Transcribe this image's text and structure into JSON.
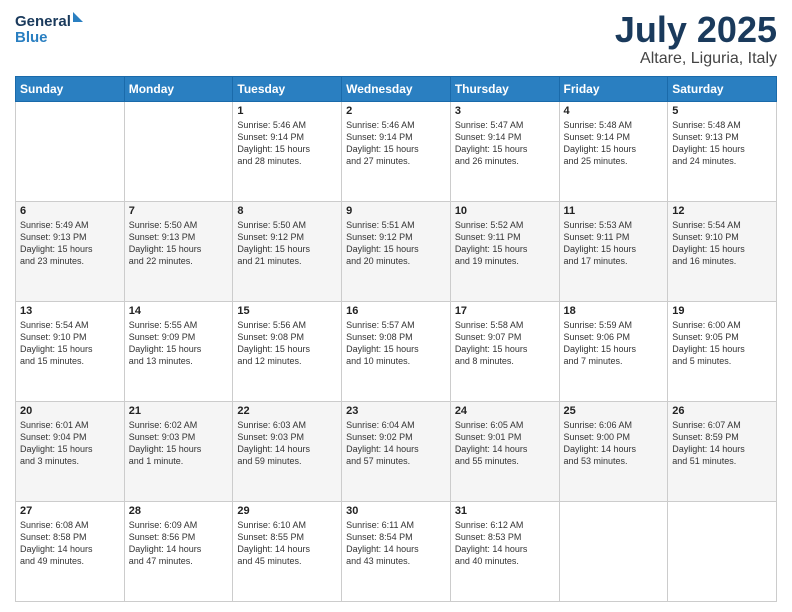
{
  "header": {
    "logo_line1": "General",
    "logo_line2": "Blue",
    "main_title": "July 2025",
    "subtitle": "Altare, Liguria, Italy"
  },
  "days_of_week": [
    "Sunday",
    "Monday",
    "Tuesday",
    "Wednesday",
    "Thursday",
    "Friday",
    "Saturday"
  ],
  "weeks": [
    [
      {
        "day": "",
        "content": ""
      },
      {
        "day": "",
        "content": ""
      },
      {
        "day": "1",
        "content": "Sunrise: 5:46 AM\nSunset: 9:14 PM\nDaylight: 15 hours\nand 28 minutes."
      },
      {
        "day": "2",
        "content": "Sunrise: 5:46 AM\nSunset: 9:14 PM\nDaylight: 15 hours\nand 27 minutes."
      },
      {
        "day": "3",
        "content": "Sunrise: 5:47 AM\nSunset: 9:14 PM\nDaylight: 15 hours\nand 26 minutes."
      },
      {
        "day": "4",
        "content": "Sunrise: 5:48 AM\nSunset: 9:14 PM\nDaylight: 15 hours\nand 25 minutes."
      },
      {
        "day": "5",
        "content": "Sunrise: 5:48 AM\nSunset: 9:13 PM\nDaylight: 15 hours\nand 24 minutes."
      }
    ],
    [
      {
        "day": "6",
        "content": "Sunrise: 5:49 AM\nSunset: 9:13 PM\nDaylight: 15 hours\nand 23 minutes."
      },
      {
        "day": "7",
        "content": "Sunrise: 5:50 AM\nSunset: 9:13 PM\nDaylight: 15 hours\nand 22 minutes."
      },
      {
        "day": "8",
        "content": "Sunrise: 5:50 AM\nSunset: 9:12 PM\nDaylight: 15 hours\nand 21 minutes."
      },
      {
        "day": "9",
        "content": "Sunrise: 5:51 AM\nSunset: 9:12 PM\nDaylight: 15 hours\nand 20 minutes."
      },
      {
        "day": "10",
        "content": "Sunrise: 5:52 AM\nSunset: 9:11 PM\nDaylight: 15 hours\nand 19 minutes."
      },
      {
        "day": "11",
        "content": "Sunrise: 5:53 AM\nSunset: 9:11 PM\nDaylight: 15 hours\nand 17 minutes."
      },
      {
        "day": "12",
        "content": "Sunrise: 5:54 AM\nSunset: 9:10 PM\nDaylight: 15 hours\nand 16 minutes."
      }
    ],
    [
      {
        "day": "13",
        "content": "Sunrise: 5:54 AM\nSunset: 9:10 PM\nDaylight: 15 hours\nand 15 minutes."
      },
      {
        "day": "14",
        "content": "Sunrise: 5:55 AM\nSunset: 9:09 PM\nDaylight: 15 hours\nand 13 minutes."
      },
      {
        "day": "15",
        "content": "Sunrise: 5:56 AM\nSunset: 9:08 PM\nDaylight: 15 hours\nand 12 minutes."
      },
      {
        "day": "16",
        "content": "Sunrise: 5:57 AM\nSunset: 9:08 PM\nDaylight: 15 hours\nand 10 minutes."
      },
      {
        "day": "17",
        "content": "Sunrise: 5:58 AM\nSunset: 9:07 PM\nDaylight: 15 hours\nand 8 minutes."
      },
      {
        "day": "18",
        "content": "Sunrise: 5:59 AM\nSunset: 9:06 PM\nDaylight: 15 hours\nand 7 minutes."
      },
      {
        "day": "19",
        "content": "Sunrise: 6:00 AM\nSunset: 9:05 PM\nDaylight: 15 hours\nand 5 minutes."
      }
    ],
    [
      {
        "day": "20",
        "content": "Sunrise: 6:01 AM\nSunset: 9:04 PM\nDaylight: 15 hours\nand 3 minutes."
      },
      {
        "day": "21",
        "content": "Sunrise: 6:02 AM\nSunset: 9:03 PM\nDaylight: 15 hours\nand 1 minute."
      },
      {
        "day": "22",
        "content": "Sunrise: 6:03 AM\nSunset: 9:03 PM\nDaylight: 14 hours\nand 59 minutes."
      },
      {
        "day": "23",
        "content": "Sunrise: 6:04 AM\nSunset: 9:02 PM\nDaylight: 14 hours\nand 57 minutes."
      },
      {
        "day": "24",
        "content": "Sunrise: 6:05 AM\nSunset: 9:01 PM\nDaylight: 14 hours\nand 55 minutes."
      },
      {
        "day": "25",
        "content": "Sunrise: 6:06 AM\nSunset: 9:00 PM\nDaylight: 14 hours\nand 53 minutes."
      },
      {
        "day": "26",
        "content": "Sunrise: 6:07 AM\nSunset: 8:59 PM\nDaylight: 14 hours\nand 51 minutes."
      }
    ],
    [
      {
        "day": "27",
        "content": "Sunrise: 6:08 AM\nSunset: 8:58 PM\nDaylight: 14 hours\nand 49 minutes."
      },
      {
        "day": "28",
        "content": "Sunrise: 6:09 AM\nSunset: 8:56 PM\nDaylight: 14 hours\nand 47 minutes."
      },
      {
        "day": "29",
        "content": "Sunrise: 6:10 AM\nSunset: 8:55 PM\nDaylight: 14 hours\nand 45 minutes."
      },
      {
        "day": "30",
        "content": "Sunrise: 6:11 AM\nSunset: 8:54 PM\nDaylight: 14 hours\nand 43 minutes."
      },
      {
        "day": "31",
        "content": "Sunrise: 6:12 AM\nSunset: 8:53 PM\nDaylight: 14 hours\nand 40 minutes."
      },
      {
        "day": "",
        "content": ""
      },
      {
        "day": "",
        "content": ""
      }
    ]
  ]
}
